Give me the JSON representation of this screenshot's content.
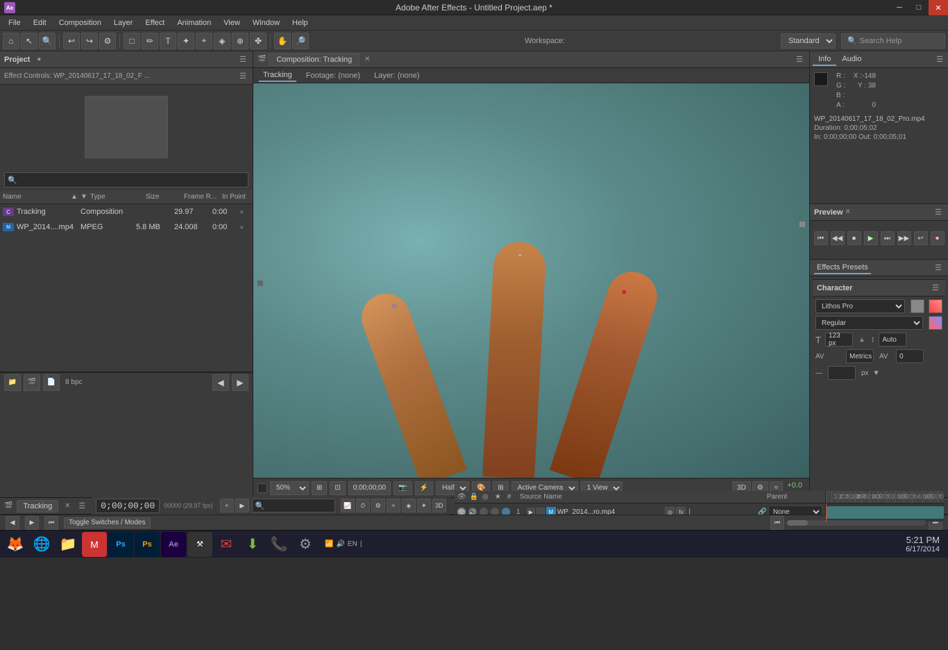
{
  "app": {
    "title": "Adobe After Effects - Untitled Project.aep *",
    "logo": "Ae"
  },
  "window_controls": {
    "minimize": "─",
    "maximize": "□",
    "close": "✕"
  },
  "menu": {
    "items": [
      "File",
      "Edit",
      "Composition",
      "Layer",
      "Effect",
      "Animation",
      "View",
      "Window",
      "Help"
    ]
  },
  "toolbar": {
    "workspace_label": "Workspace:",
    "workspace_value": "Standard",
    "search_placeholder": "Search Help"
  },
  "project_panel": {
    "title": "Project",
    "effect_controls_label": "Effect Controls: WP_20140617_17_18_02_F ...",
    "search_placeholder": "🔍",
    "columns": {
      "name": "Name",
      "type": "Type",
      "size": "Size",
      "frame_rate": "Frame R...",
      "in_point": "In Point"
    },
    "items": [
      {
        "name": "Tracking",
        "type": "Composition",
        "size": "",
        "frame_rate": "29.97",
        "in_point": "0:00",
        "icon_type": "comp"
      },
      {
        "name": "WP_2014....mp4",
        "type": "MPEG",
        "size": "5.8 MB",
        "frame_rate": "24.008",
        "in_point": "0:00",
        "icon_type": "mpeg"
      }
    ]
  },
  "composition_panel": {
    "title": "Composition: Tracking",
    "tab_label": "Tracking",
    "footage_tab": "Footage: (none)",
    "layer_tab": "Layer: (none)"
  },
  "comp_toolbar": {
    "zoom": "50%",
    "timecode": "0;00;00;00",
    "quality": "Half",
    "view": "Active Camera",
    "view_count": "1 View"
  },
  "info_panel": {
    "tabs": [
      "Info",
      "Audio"
    ],
    "r_label": "R :",
    "g_label": "G :",
    "b_label": "B :",
    "a_label": "A :",
    "r_value": "",
    "g_value": "",
    "b_value": "",
    "a_value": "0",
    "x_label": "X :",
    "x_value": "-148",
    "y_label": "Y :",
    "y_value": "38",
    "filename": "WP_20140617_17_18_02_Pro.mp4",
    "duration": "Duration: 0;00;05;02",
    "in_out": "In: 0;00;00;00  Out: 0;00;05;01"
  },
  "preview_panel": {
    "title": "Preview",
    "controls": [
      "⏮",
      "⏪",
      "⏹",
      "▶",
      "⏭",
      "⏩",
      "↩",
      "⏺"
    ]
  },
  "effects_panel": {
    "tabs": [
      "Effects & Presets",
      "Character"
    ],
    "title": "Effects Presets"
  },
  "character_panel": {
    "title": "Character",
    "font": "Lithos Pro",
    "style": "Regular",
    "size": "123 px",
    "auto_label": "Auto",
    "metrics_label": "Metrics",
    "av_value": "0",
    "px_label": "px"
  },
  "timeline": {
    "tab_label": "Tracking",
    "timecode": "0;00;00;00",
    "fps": "00000 (29.97 fps)",
    "ruler_marks": [
      "10f",
      "20f",
      "01:00F",
      "10f",
      "20f",
      "02:00F",
      "10f",
      "20f",
      "03:00F",
      "10f",
      "20f",
      "04:00F",
      "10f",
      "20f",
      "05:00F"
    ],
    "columns": {
      "source": "Source Name",
      "parent": "Parent"
    },
    "layers": [
      {
        "num": "1",
        "name": "WP_2014...ro.mp4",
        "parent": "None",
        "icon_type": "mpeg"
      }
    ]
  },
  "status_bar": {
    "bpc": "8 bpc",
    "toggle_switches": "Toggle Switches / Modes"
  },
  "taskbar": {
    "clock": "5:21 PM",
    "date": "6/17/2014",
    "icons": [
      "🦊",
      "🌐",
      "📁",
      "🎯",
      "🖊",
      "🖊",
      "Ae",
      "🔧",
      "✉"
    ],
    "systray": "🔊 EN"
  }
}
